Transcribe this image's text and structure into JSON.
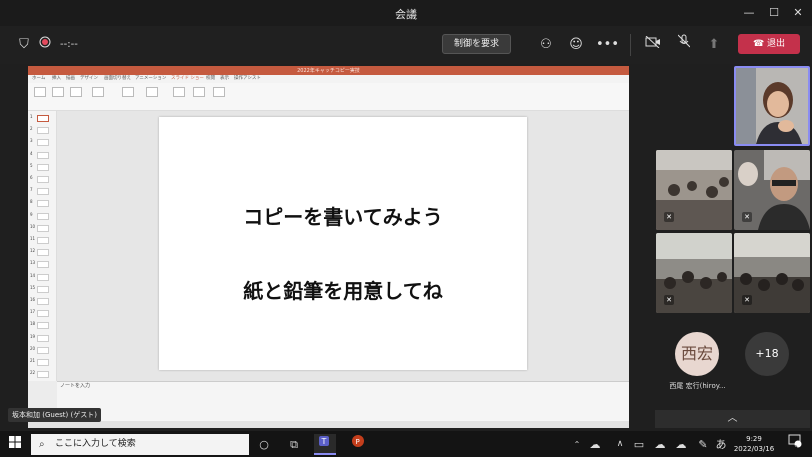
{
  "window": {
    "title": "会議"
  },
  "toolbar": {
    "status_text": "--:--",
    "control_button": "制御を要求",
    "leave_button": "退出",
    "icons": [
      "shield-icon",
      "record-icon",
      "participants-icon",
      "reactions-icon",
      "more-icon",
      "camera-off-icon",
      "mic-off-icon",
      "share-icon",
      "phone-icon"
    ]
  },
  "presentation": {
    "window_title": "2022年キャッチコピー実技",
    "tabs": [
      "ホーム",
      "挿入",
      "描画",
      "デザイン",
      "画面切り替え",
      "アニメーション",
      "スライド ショー",
      "校閲",
      "表示",
      "操作アシスト"
    ],
    "slide_numbers": [
      "1",
      "2",
      "3",
      "4",
      "5",
      "6",
      "7",
      "8",
      "9",
      "10",
      "11",
      "12",
      "13",
      "14",
      "15",
      "16",
      "17",
      "18",
      "19",
      "20",
      "21",
      "22"
    ],
    "slide_line1": "コピーを書いてみよう",
    "slide_line2": "紙と鉛筆を用意してね",
    "notes_placeholder": "ノートを入力"
  },
  "presenter_label": "坂本和加 (Guest) (ゲスト)",
  "participants": {
    "avatar_initials": "西宏",
    "avatar_name": "西尾 宏行(hiroy...",
    "more_count": "+18"
  },
  "taskbar": {
    "search_placeholder": "ここに入力して検索",
    "time": "9:29",
    "date": "2022/03/16",
    "ime": "あ",
    "notification_count": "2"
  },
  "colors": {
    "leave": "#c4314b",
    "self_border": "#8a8cf2",
    "ppt_accent": "#c55a3f"
  }
}
